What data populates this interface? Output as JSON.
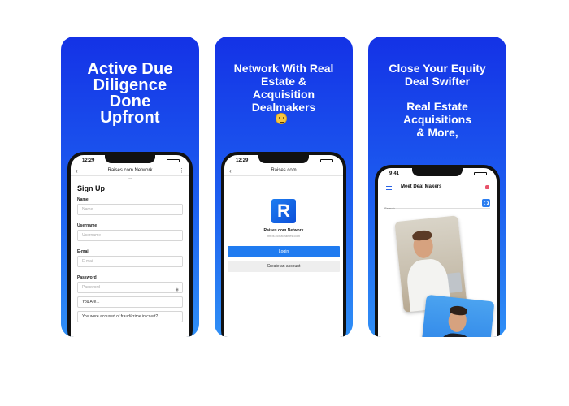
{
  "card1": {
    "headline": [
      "Active Due",
      "Diligence",
      "Done",
      "Upfront"
    ],
    "status_time": "12:29",
    "nav_title": "Raises.com Network",
    "nav_sub": "om",
    "form_title": "Sign Up",
    "fields": [
      {
        "label": "Name",
        "placeholder": "Name"
      },
      {
        "label": "Username",
        "placeholder": "Username"
      },
      {
        "label": "E-mail",
        "placeholder": "E-mail"
      },
      {
        "label": "Password",
        "placeholder": "Password"
      }
    ],
    "select_you_are": "You Are...",
    "question": "You were accused of fraud/crime in court?"
  },
  "card2": {
    "headline": [
      "Network With Real",
      "Estate &",
      "Acquisition",
      "Dealmakers"
    ],
    "status_time": "12:29",
    "nav_title": "Raises.com",
    "logo_letter": "R",
    "brand_name": "Raises.com Network",
    "brand_url": "https://chat.raises.com",
    "login_label": "Login",
    "create_label": "Create an account"
  },
  "card3": {
    "headline_a": [
      "Close Your Equity",
      "Deal Swifter"
    ],
    "headline_b": [
      "Real Estate",
      "Acquisitions",
      "& More,"
    ],
    "status_time": "9:41",
    "screen_title": "Meet Deal Makers",
    "search_placeholder": "Search"
  }
}
